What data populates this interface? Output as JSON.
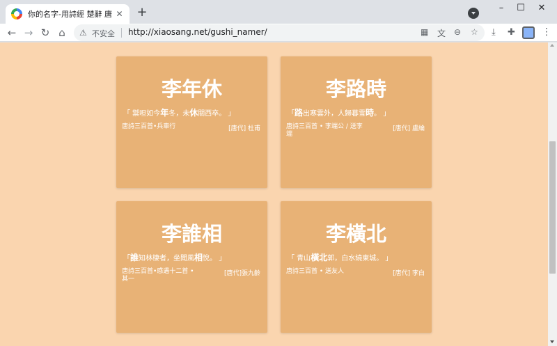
{
  "browser": {
    "tab_title": "你的名字-用詩經 楚辭 唐詩 宋詞",
    "tab_close": "✕",
    "new_tab": "+",
    "insecure_label": "不安全",
    "url": "http://xiaosang.net/gushi_namer/"
  },
  "cards": [
    {
      "name": "李年休",
      "verse": {
        "open": "「 禦呾如今",
        "c1": "年",
        "mid": "冬，未",
        "c2": "休",
        "close": "關西卒。 」"
      },
      "source": "唐詩三百首•兵車行",
      "author": "[唐代] 杜甫"
    },
    {
      "name": "李路時",
      "verse": {
        "open": "「",
        "c1": "路",
        "mid": "出寒雲外，人歸暮雪",
        "c2": "時",
        "close": "。 」"
      },
      "source": "唐詩三百首 • 李端公 / 送李端",
      "author": "[唐代] 盧綸"
    },
    {
      "name": "李誰相",
      "verse": {
        "open": "「",
        "c1": "誰",
        "mid": "知林棲者，坐聞風",
        "c2": "相",
        "close": "悅。 」"
      },
      "source": "唐詩三百首•感遇十二首 •其一",
      "author": "[唐代]張九齡"
    },
    {
      "name": "李橫北",
      "verse": {
        "open": "「 青山",
        "c1": "橫",
        "mid": "",
        "c2": "北",
        "close": "郭，白水繞東城。 」"
      },
      "source": "唐詩三百首 • 送友人",
      "author": "[唐代] 李白"
    }
  ]
}
